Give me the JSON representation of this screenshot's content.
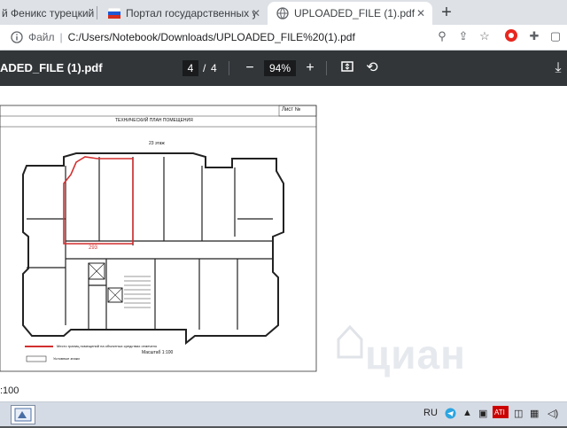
{
  "tabs": [
    {
      "title": "й Феникс турецкий с",
      "active": false
    },
    {
      "title": "Портал государственных услуг Р",
      "active": false
    },
    {
      "title": "UPLOADED_FILE (1).pdf",
      "active": true
    }
  ],
  "address": {
    "scheme_label": "Файл",
    "url": "C:/Users/Notebook/Downloads/UPLOADED_FILE%20(1).pdf"
  },
  "pdf": {
    "title": "ADED_FILE (1).pdf",
    "current_page": "4",
    "page_sep": "/",
    "total_pages": "4",
    "zoom": "94%"
  },
  "drawing": {
    "sheet_label": "Лист №",
    "header_title": "ТЕХНИЧЕСКИЙ ПЛАН ПОМЕЩЕНИЯ",
    "floor_label": "23 этаж",
    "room_number": "293",
    "scale_label": "Масштаб 1:100",
    "scale_bottom": ":100",
    "legend1": "Место границ помещений на объектных средствах отмечено",
    "legend2": "Условные знаки"
  },
  "watermark": "циан",
  "taskbar": {
    "lang": "RU"
  },
  "colors": {
    "pdf_toolbar": "#323639",
    "tabstrip": "#dee1e6",
    "highlight": "#d32f2f"
  }
}
